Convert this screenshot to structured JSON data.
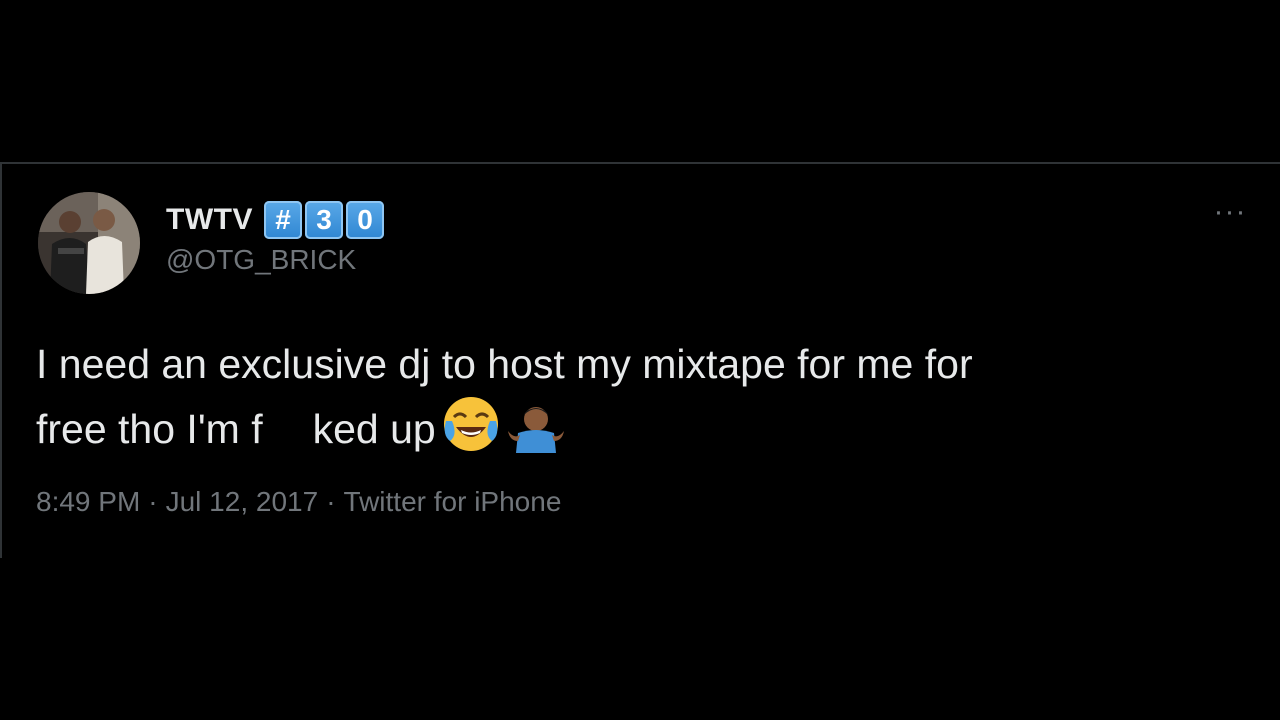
{
  "tweet": {
    "display_name": "TWTV",
    "badge_keys": [
      "#",
      "3",
      "0"
    ],
    "handle": "@OTG_BRICK",
    "more_label": "···",
    "text_line1": "I need an exclusive dj to host my mixtape for me for",
    "text_line2_a": "free tho I'm f",
    "text_line2_b": "ked up",
    "emojis": [
      "face-with-tears-of-joy",
      "person-shrugging"
    ],
    "time": "8:49 PM",
    "separator": "·",
    "date": "Jul 12, 2017",
    "source": "Twitter for iPhone"
  },
  "colors": {
    "background": "#000000",
    "primary_text": "#e7e9ea",
    "secondary_text": "#71767b",
    "keycap_blue": "#3d93dc",
    "border": "#2f3336"
  }
}
